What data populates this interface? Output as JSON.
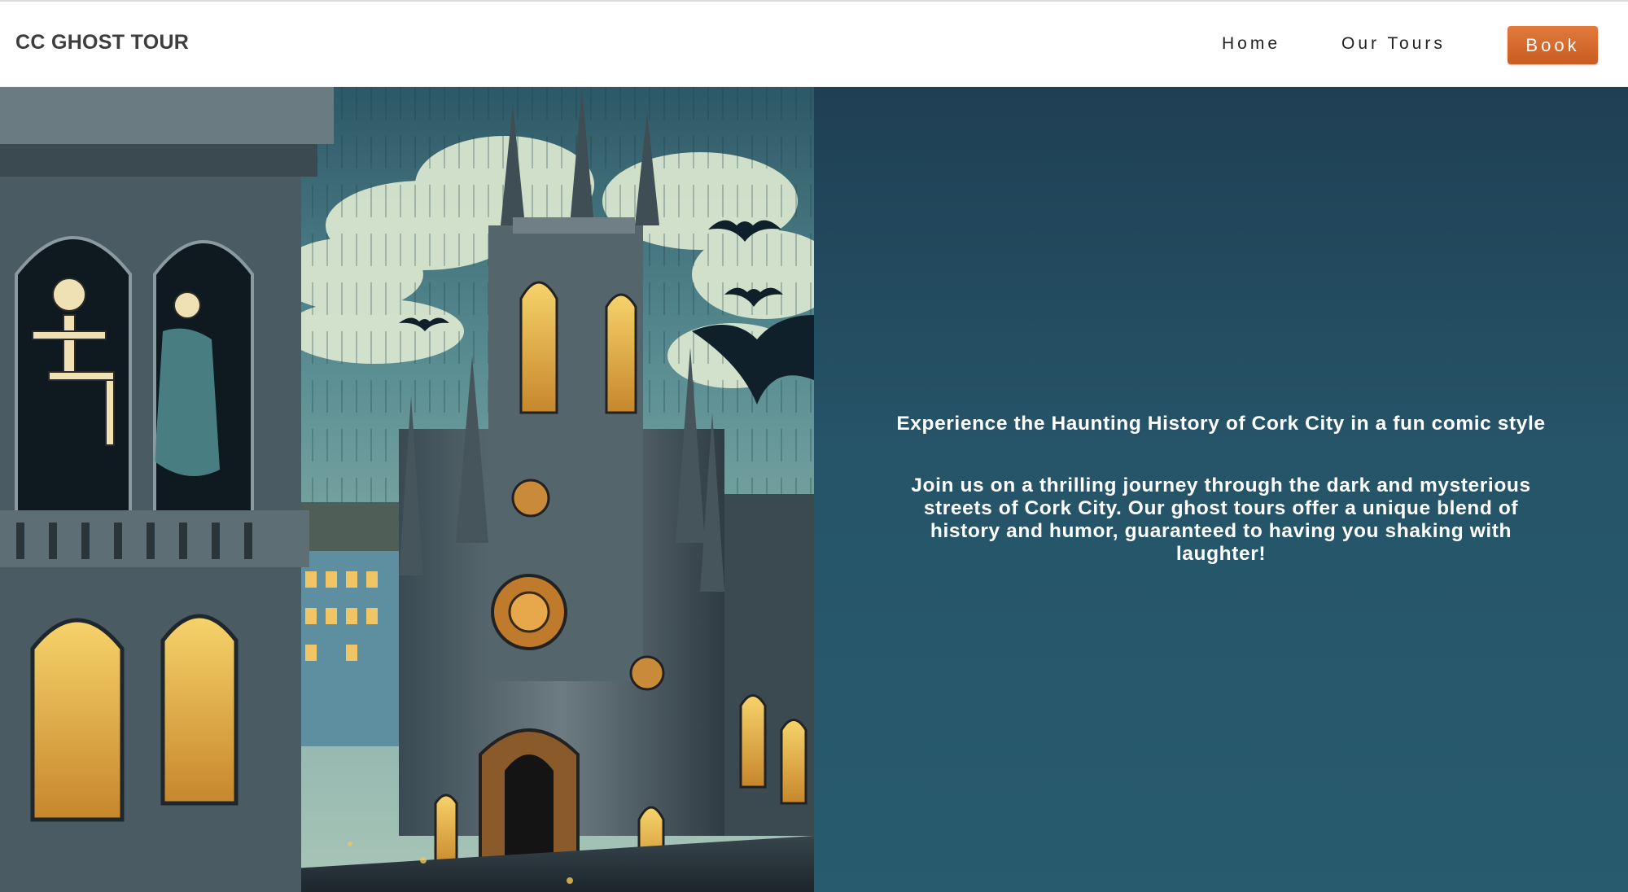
{
  "header": {
    "brand": "CC GHOST TOUR",
    "nav": {
      "home_label": "Home",
      "tours_label": "Our Tours",
      "book_label": "Book"
    }
  },
  "hero": {
    "image_icon": "haunted-cathedral-illustration",
    "heading": "Experience the Haunting History of Cork City in a fun comic style",
    "body": "Join us on a thrilling journey through the dark and mysterious streets of Cork City. Our ghost tours offer a unique blend of history and humor, guaranteed to having you shaking with laughter!"
  },
  "colors": {
    "header_bg": "#ffffff",
    "brand_text": "#3d3d3d",
    "accent_button": "#d96a2c",
    "panel_top": "#1f3f54",
    "panel_bottom": "#285b6e",
    "hero_text": "#ffffff"
  }
}
